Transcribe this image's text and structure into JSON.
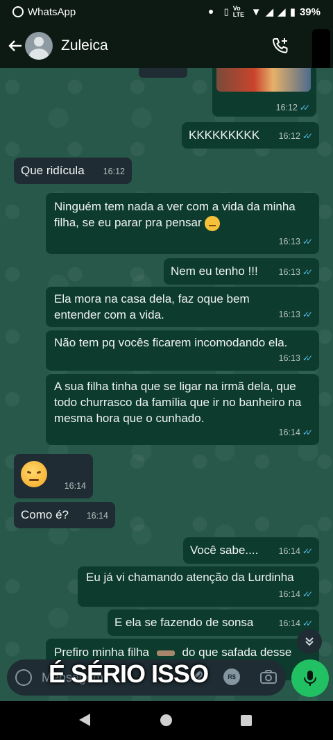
{
  "status_bar": {
    "app_name": "WhatsApp",
    "battery": "39%",
    "network": "Vo LTE"
  },
  "header": {
    "contact_name": "Zuleica"
  },
  "messages": [
    {
      "dir": "out",
      "text": "",
      "time": "16:12",
      "kind": "media"
    },
    {
      "dir": "out",
      "text": "KKKKKKKKK",
      "time": "16:12"
    },
    {
      "dir": "in",
      "text": "Que ridícula",
      "time": "16:12"
    },
    {
      "dir": "out",
      "text": "Ninguém tem nada a ver com a vida da minha filha, se eu parar pra pensar",
      "time": "16:13"
    },
    {
      "dir": "out",
      "text": "Nem eu tenho !!!",
      "time": "16:13"
    },
    {
      "dir": "out",
      "text": "Ela mora na casa dela, faz oque bem entender com a vida.",
      "time": "16:13"
    },
    {
      "dir": "out",
      "text": "Não tem pq vocês ficarem incomodando ela.",
      "time": "16:13"
    },
    {
      "dir": "out",
      "text": "A sua filha tinha que se ligar na irmã dela, que todo churrasco da família que ir no banheiro na mesma hora que o cunhado.",
      "time": "16:14"
    },
    {
      "dir": "in",
      "text": "",
      "time": "16:14",
      "kind": "emoji"
    },
    {
      "dir": "in",
      "text": "Como é?",
      "time": "16:14"
    },
    {
      "dir": "out",
      "text": "Você sabe....",
      "time": "16:14"
    },
    {
      "dir": "out",
      "text": "Eu já vi chamando atenção da Lurdinha",
      "time": "16:14"
    },
    {
      "dir": "out",
      "text": "E ela se fazendo de sonsa",
      "time": "16:14"
    },
    {
      "dir": "out",
      "text": "Prefiro minha filha",
      "text2": "do que safada desse",
      "time": ""
    }
  ],
  "composer": {
    "placeholder": "Mensagem"
  },
  "overlay_caption": "É SÉRIO ISSO",
  "icons": {
    "currency": "R$"
  },
  "colors": {
    "outgoing_bubble": "#0d3b2e",
    "incoming_bubble": "#1f2c33",
    "chat_background": "#27584a",
    "read_ticks": "#53bdeb",
    "mic_button": "#21c063"
  }
}
